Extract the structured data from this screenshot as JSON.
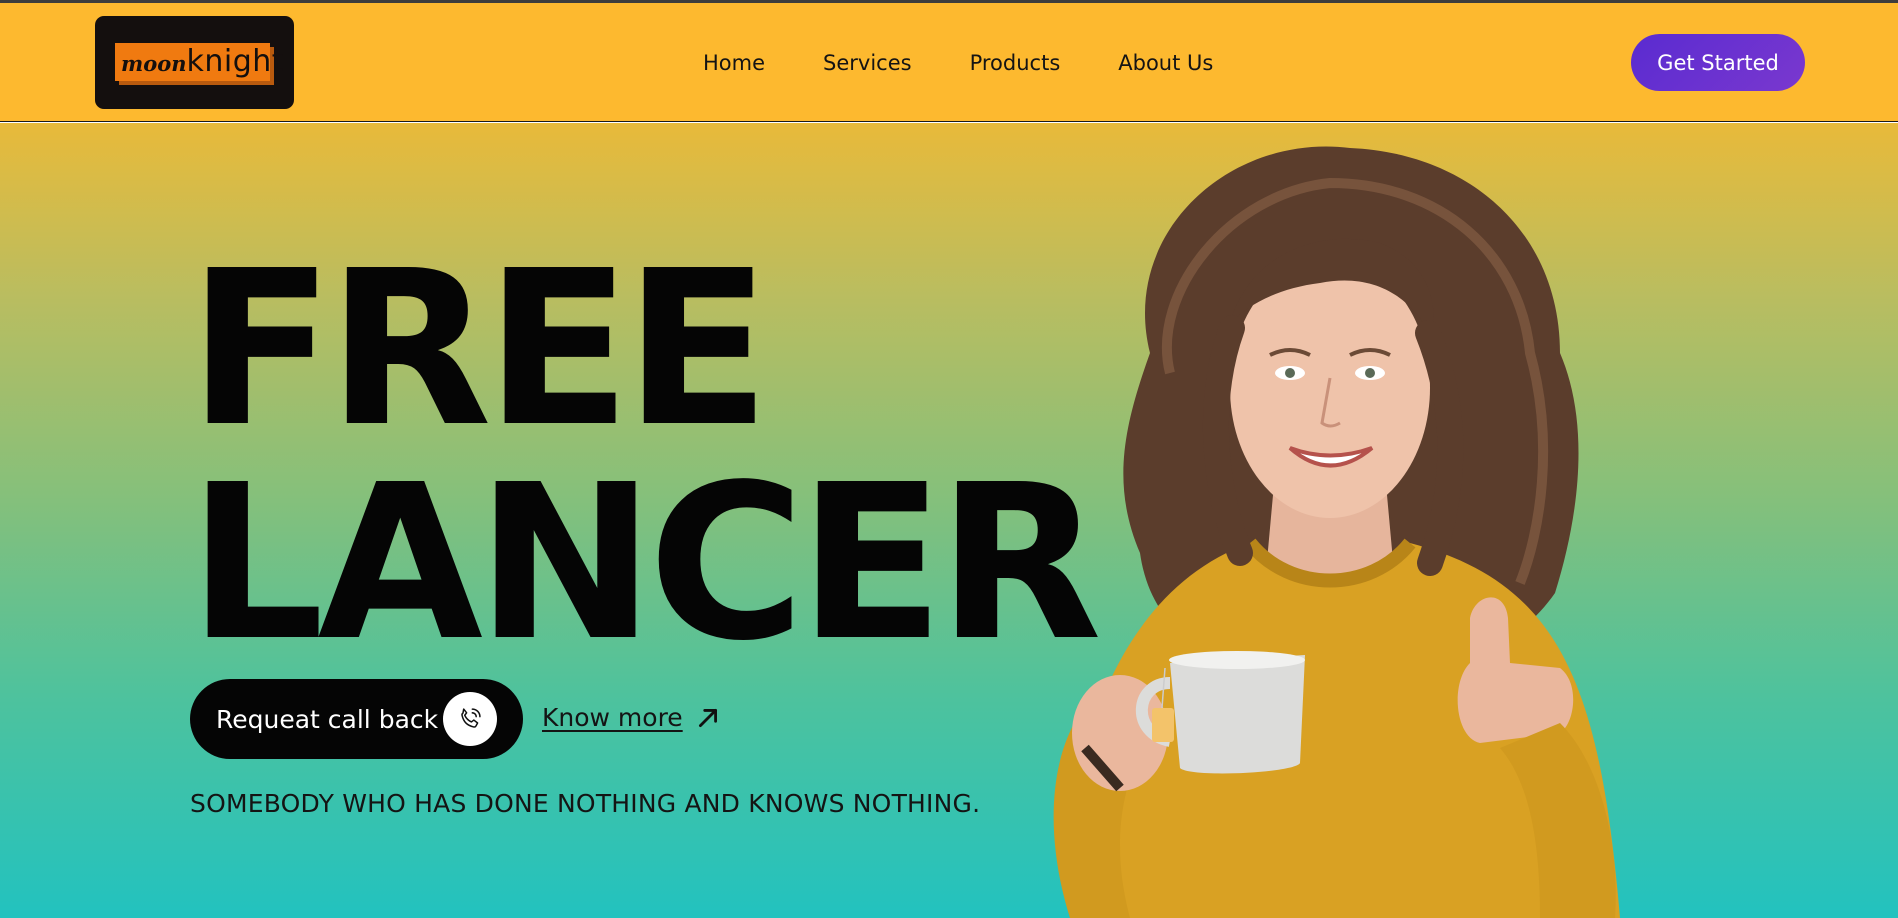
{
  "logo": {
    "part_a": "moon",
    "part_b": "knight"
  },
  "nav": {
    "links": [
      {
        "label": "Home"
      },
      {
        "label": "Services"
      },
      {
        "label": "Products"
      },
      {
        "label": "About Us"
      }
    ],
    "cta_label": "Get Started"
  },
  "hero": {
    "headline_line1": "FREE",
    "headline_line2": "LANCER",
    "callback_label": "Requeat call back",
    "know_more_label": "Know more",
    "tagline": "SOMEBODY WHO HAS DONE NOTHING AND KNOWS NOTHING."
  },
  "icons": {
    "callback": "phone-icon",
    "know_more": "arrow-up-right-icon"
  },
  "colors": {
    "navbar_bg": "#fdb92f",
    "logo_bg": "#140f0e",
    "logo_accent": "#f07a10",
    "cta_bg": "#6a30d0",
    "hero_gradient_top": "#e8ba3a",
    "hero_gradient_bottom": "#22c2bf",
    "text_dark": "#050505"
  }
}
